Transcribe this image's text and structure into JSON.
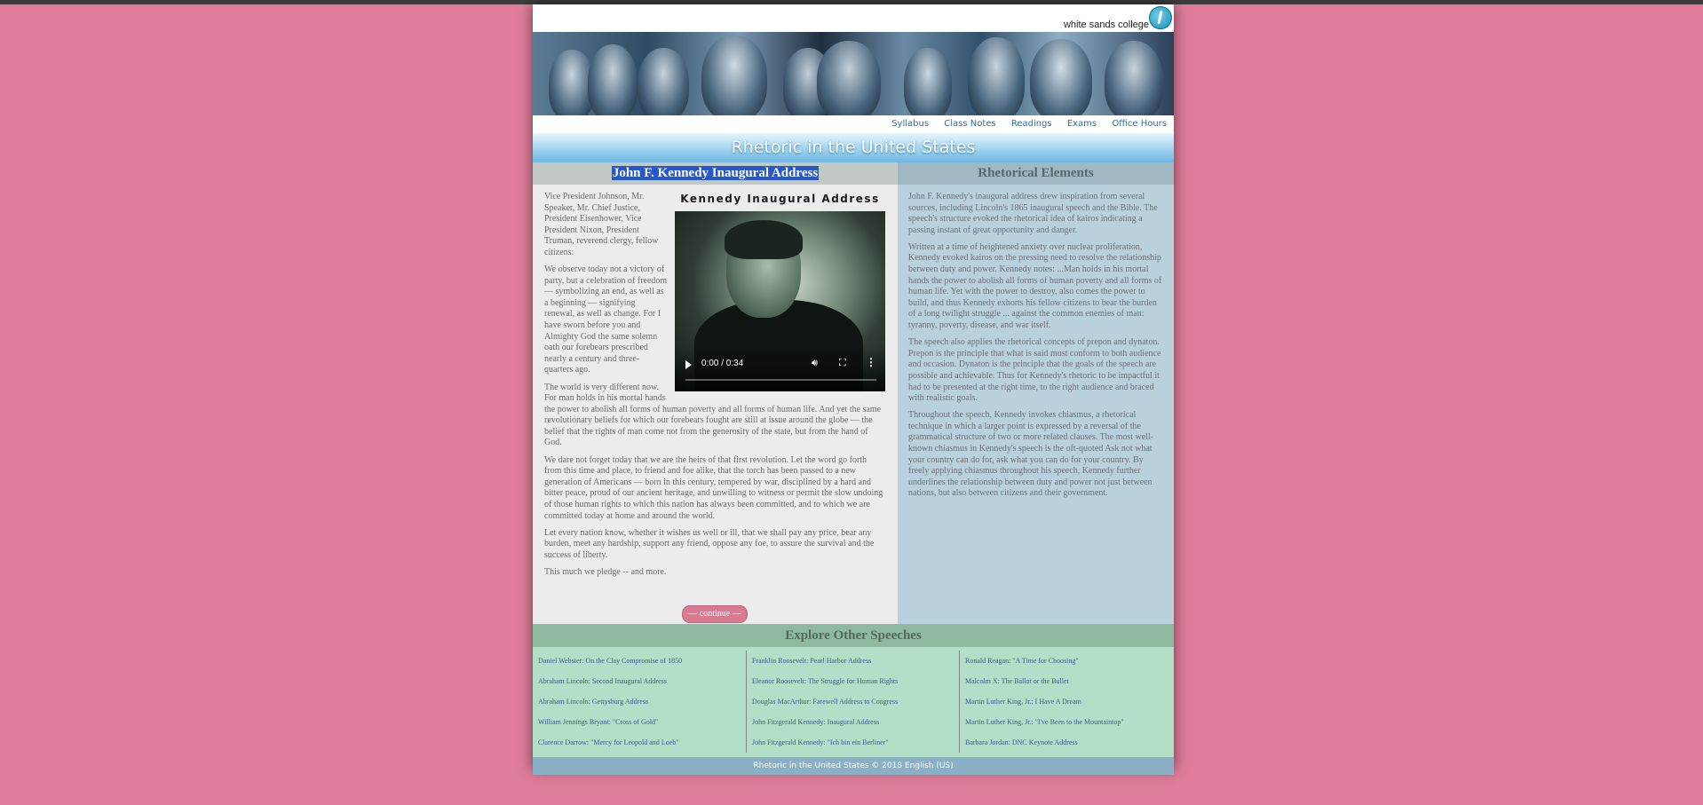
{
  "site": {
    "brand": "white sands college",
    "title": "Rhetoric in the United States"
  },
  "nav": [
    "Syllabus",
    "Class Notes",
    "Readings",
    "Exams",
    "Office Hours"
  ],
  "speech": {
    "heading": "John F. Kennedy Inaugural Address",
    "media_title": "Kennedy Inaugural Address",
    "video": {
      "time": "0:00 / 0:34",
      "progress": 0
    },
    "paragraphs": [
      "Vice President Johnson, Mr. Speaker, Mr. Chief Justice, President Eisenhower, Vice President Nixon, President Truman, reverend clergy, fellow citizens:",
      "We observe today not a victory of party, but a celebration of freedom — symbolizing an end, as well as a beginning — signifying renewal, as well as change. For I have sworn before you and Almighty God the same solemn oath our forebears prescribed nearly a century and three-quarters ago.",
      "The world is very different now. For man holds in his mortal hands the power to abolish all forms of human poverty and all forms of human life. And yet the same revolutionary beliefs for which our forebears fought are still at issue around the globe — the belief that the rights of man come not from the generosity of the state, but from the hand of God.",
      "We dare not forget today that we are the heirs of that first revolution. Let the word go forth from this time and place, to friend and foe alike, that the torch has been passed to a new generation of Americans — born in this century, tempered by war, disciplined by a hard and bitter peace, proud of our ancient heritage, and unwilling to witness or permit the slow undoing of those human rights to which this nation has always been committed, and to which we are committed today at home and around the world.",
      "Let every nation know, whether it wishes us well or ill, that we shall pay any price, bear any burden, meet any hardship, support any friend, oppose any foe, to assure the survival and the success of liberty.",
      "This much we pledge -- and more."
    ],
    "continue_label": "— continue —"
  },
  "elements": {
    "heading": "Rhetorical Elements",
    "paragraphs": [
      "John F. Kennedy's inaugural address drew inspiration from several sources, including Lincoln's 1865 inaugural speech and the Bible. The speech's structure evoked the rhetorical idea of kairos indicating a passing instant of great opportunity and danger.",
      "Written at a time of heightened anxiety over nuclear proliferation, Kennedy evoked kairos on the pressing need to resolve the relationship between duty and power. Kennedy notes: ...Man holds in his mortal hands the power to abolish all forms of human poverty and all forms of human life. Yet with the power to destroy, also comes the power to build, and thus Kennedy exhorts his fellow citizens to bear the burden of a long twilight struggle ... against the common enemies of man: tyranny, poverty, disease, and war itself.",
      "The speech also applies the rhetorical concepts of prepon and dynaton. Prepon is the principle that what is said must conform to both audience and occasion. Dynaton is the principle that the goals of the speech are possible and achievable. Thus for Kennedy's rhetoric to be impactful it had to be presented at the right time, to the right audience and braced with realistic goals.",
      "Throughout the speech, Kennedy invokes chiasmus, a rhetorical technique in which a larger point is expressed by a reversal of the grammatical structure of two or more related clauses. The most well-known chiasmus in Kennedy's speech is the oft-quoted Ask not what your country can do for, ask what you can do for your country. By freely applying chiasmus throughout his speech, Kennedy further underlines the relationship between duty and power not just between nations, but also between citizens and their government."
    ]
  },
  "explore": {
    "heading": "Explore Other Speeches",
    "columns": [
      [
        "Daniel Webster: On the Clay Compromise of 1850",
        "Abraham Lincoln: Second Inaugural Address",
        "Abraham Lincoln: Gettysburg Address",
        "William Jennings Bryant: \"Cross of Gold\"",
        "Clarence Darrow: \"Mercy for Leopold and Loeb\""
      ],
      [
        "Franklin Roosevelt: Pearl Harbor Address",
        "Eleanor Roosevelt: The Struggle for Human Rights",
        "Douglas MacArthur: Farewell Address to Congress",
        "John Fitzgerald Kennedy: Inaugural Address",
        "John Fitzgerald Kennedy: \"Ich bin ein Berliner\""
      ],
      [
        "Ronald Reagan: \"A Time for Choosing\"",
        "Malcolm X: The Ballot or the Bullet",
        "Martin Luther King, Jr.: I Have A Dream",
        "Martin Luther King, Jr.: \"I've Been to the Mountaintop\"",
        "Barbara Jordan: DNC Keynote Address"
      ]
    ]
  },
  "footer": "Rhetoric in the United States © 2018 English (US)"
}
